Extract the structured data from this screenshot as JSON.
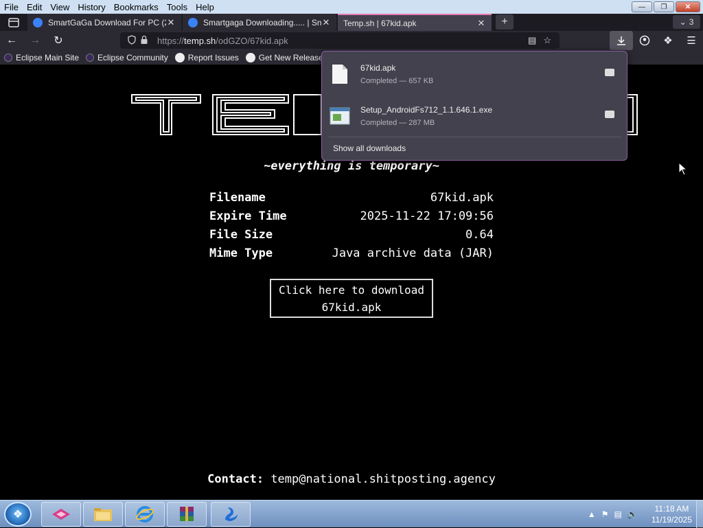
{
  "menubar": {
    "items": [
      "File",
      "Edit",
      "View",
      "History",
      "Bookmarks",
      "Tools",
      "Help"
    ]
  },
  "tabs": [
    {
      "title": "SmartGaGa Download For PC (2",
      "active": false
    },
    {
      "title": "Smartgaga Downloading..... | Sn",
      "active": false
    },
    {
      "title": "Temp.sh | 67kid.apk",
      "active": true
    }
  ],
  "tab_count": "3",
  "address": {
    "prefix": "https://",
    "host": "temp.sh",
    "path": "/odGZO/67kid.apk"
  },
  "bookmarks": [
    "Eclipse Main Site",
    "Eclipse Community",
    "Report Issues",
    "Get New Releases"
  ],
  "page": {
    "tagline": "~everything is temporary~",
    "info": [
      {
        "key": "Filename",
        "value": "67kid.apk"
      },
      {
        "key": "Expire Time",
        "value": "2025-11-22 17:09:56"
      },
      {
        "key": "File Size",
        "value": "0.64"
      },
      {
        "key": "Mime Type",
        "value": "Java archive data (JAR)"
      }
    ],
    "download_line1": "Click here to download",
    "download_line2": "67kid.apk",
    "contact_label": "Contact:",
    "contact_value": "temp@national.shitposting.agency"
  },
  "downloads": {
    "items": [
      {
        "name": "67kid.apk",
        "status": "Completed — 657 KB"
      },
      {
        "name": "Setup_AndroidFs712_1.1.646.1.exe",
        "status": "Completed — 287 MB"
      }
    ],
    "show_all": "Show all downloads"
  },
  "taskbar": {
    "time": "11:18 AM",
    "date": "11/19/2025"
  },
  "colors": {
    "active_tab_accent": "#e67ab6",
    "panel_border": "#8a5ea0",
    "page_bg": "#000000"
  }
}
